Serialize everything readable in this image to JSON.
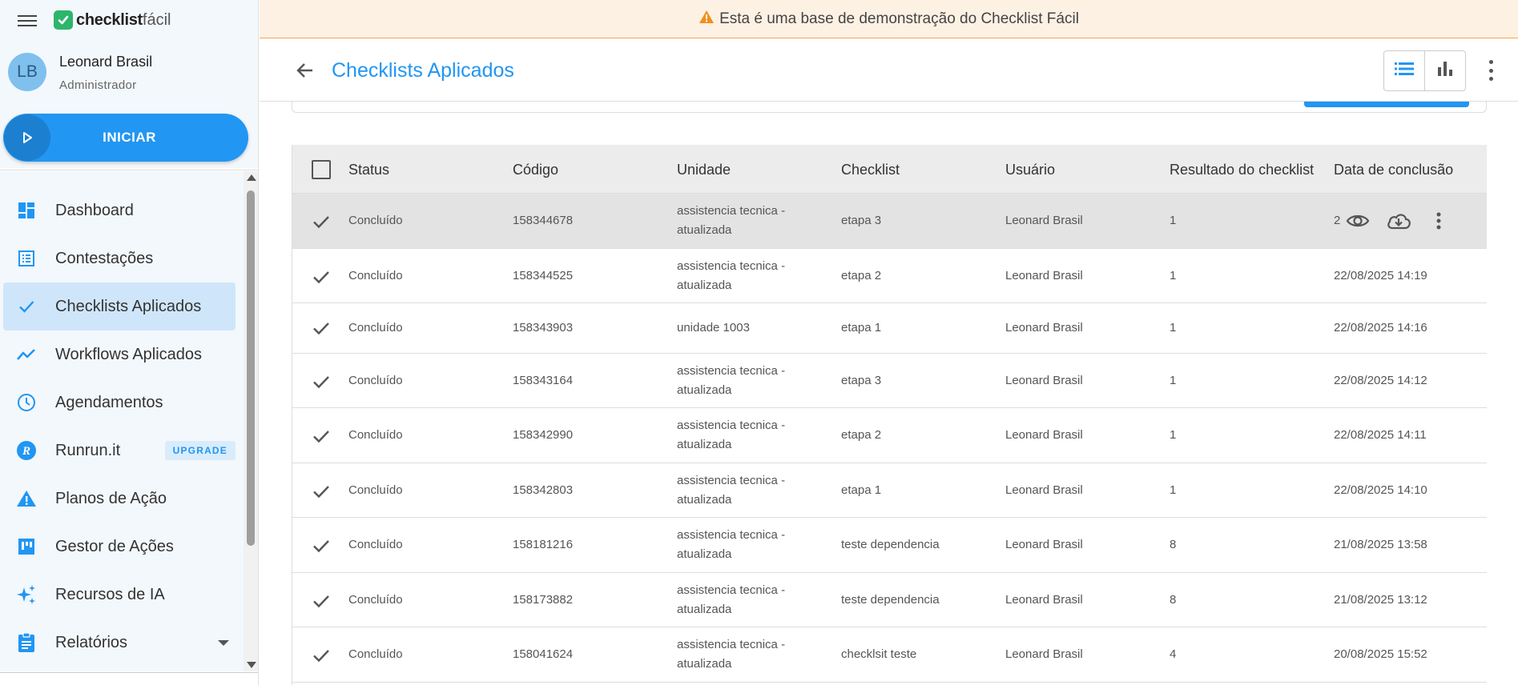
{
  "app": {
    "logo_bold": "checklist",
    "logo_light": "fácil"
  },
  "user": {
    "initials": "LB",
    "name": "Leonard Brasil",
    "role": "Administrador"
  },
  "start_button": {
    "label": "INICIAR"
  },
  "nav": [
    {
      "label": "Dashboard",
      "icon": "dashboard-icon",
      "active": false
    },
    {
      "label": "Contestações",
      "icon": "list-icon",
      "active": false
    },
    {
      "label": "Checklists Aplicados",
      "icon": "check-icon",
      "active": true
    },
    {
      "label": "Workflows Aplicados",
      "icon": "trending-icon",
      "active": false
    },
    {
      "label": "Agendamentos",
      "icon": "clock-icon",
      "active": false
    },
    {
      "label": "Runrun.it",
      "icon": "runrun-icon",
      "active": false,
      "badge": "UPGRADE"
    },
    {
      "label": "Planos de Ação",
      "icon": "warning-icon",
      "active": false
    },
    {
      "label": "Gestor de Ações",
      "icon": "kanban-icon",
      "active": false
    },
    {
      "label": "Recursos de IA",
      "icon": "sparkle-icon",
      "active": false
    },
    {
      "label": "Relatórios",
      "icon": "clipboard-icon",
      "active": false
    }
  ],
  "banner": {
    "text": "Esta é uma base de demonstração do Checklist Fácil",
    "icon": "warning-icon"
  },
  "header": {
    "title": "Checklists Aplicados"
  },
  "table": {
    "columns": [
      "Status",
      "Código",
      "Unidade",
      "Checklist",
      "Usuário",
      "Resultado do checklist",
      "Data de conclusão"
    ],
    "rows": [
      {
        "status": "Concluído",
        "code": "158344678",
        "unit_line1": "assistencia tecnica -",
        "unit_line2": "atualizada",
        "checklist": "etapa 3",
        "user": "Leonard Brasil",
        "result": "1",
        "date": "2"
      },
      {
        "status": "Concluído",
        "code": "158344525",
        "unit_line1": "assistencia tecnica -",
        "unit_line2": "atualizada",
        "checklist": "etapa 2",
        "user": "Leonard Brasil",
        "result": "1",
        "date": "22/08/2025 14:19"
      },
      {
        "status": "Concluído",
        "code": "158343903",
        "unit_line1": "unidade 1003",
        "unit_line2": "",
        "checklist": "etapa 1",
        "user": "Leonard Brasil",
        "result": "1",
        "date": "22/08/2025 14:16"
      },
      {
        "status": "Concluído",
        "code": "158343164",
        "unit_line1": "assistencia tecnica -",
        "unit_line2": "atualizada",
        "checklist": "etapa 3",
        "user": "Leonard Brasil",
        "result": "1",
        "date": "22/08/2025 14:12"
      },
      {
        "status": "Concluído",
        "code": "158342990",
        "unit_line1": "assistencia tecnica -",
        "unit_line2": "atualizada",
        "checklist": "etapa 2",
        "user": "Leonard Brasil",
        "result": "1",
        "date": "22/08/2025 14:11"
      },
      {
        "status": "Concluído",
        "code": "158342803",
        "unit_line1": "assistencia tecnica -",
        "unit_line2": "atualizada",
        "checklist": "etapa 1",
        "user": "Leonard Brasil",
        "result": "1",
        "date": "22/08/2025 14:10"
      },
      {
        "status": "Concluído",
        "code": "158181216",
        "unit_line1": "assistencia tecnica -",
        "unit_line2": "atualizada",
        "checklist": "teste dependencia",
        "user": "Leonard Brasil",
        "result": "8",
        "date": "21/08/2025 13:58"
      },
      {
        "status": "Concluído",
        "code": "158173882",
        "unit_line1": "assistencia tecnica -",
        "unit_line2": "atualizada",
        "checklist": "teste dependencia",
        "user": "Leonard Brasil",
        "result": "8",
        "date": "21/08/2025 13:12"
      },
      {
        "status": "Concluído",
        "code": "158041624",
        "unit_line1": "assistencia tecnica -",
        "unit_line2": "atualizada",
        "checklist": "checklsit teste",
        "user": "Leonard Brasil",
        "result": "4",
        "date": "20/08/2025 15:52"
      }
    ]
  },
  "colors": {
    "primary": "#2196f3",
    "active_nav": "#cfe6fa",
    "banner_bg": "#fdf1e4",
    "banner_warning": "#f0901e",
    "logo_green": "#2db56c"
  }
}
